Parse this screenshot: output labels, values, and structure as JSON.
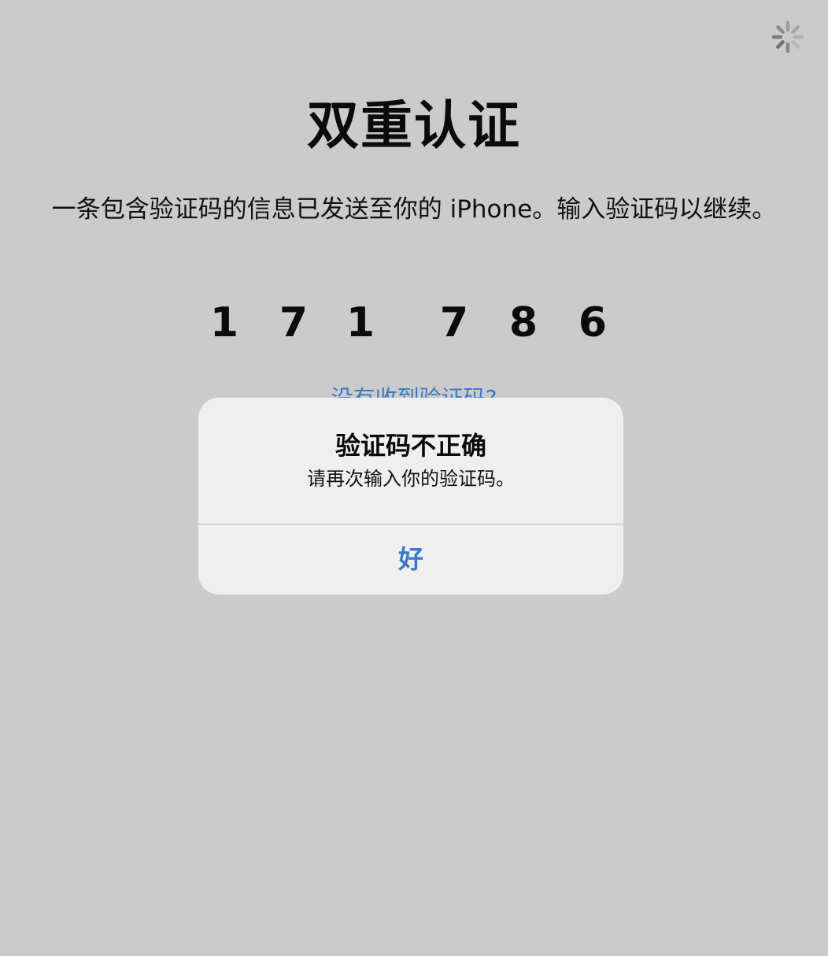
{
  "screen": {
    "title": "双重认证",
    "message": "一条包含验证码的信息已发送至你的 iPhone。输入验证码以继续。",
    "code_digits": [
      "1",
      "7",
      "1",
      "7",
      "8",
      "6"
    ],
    "resend_link": "没有收到验证码?",
    "loading_icon": "activity-spinner-icon"
  },
  "alert": {
    "title": "验证码不正确",
    "message": "请再次输入你的验证码。",
    "ok_label": "好"
  },
  "colors": {
    "background": "#cbcbcb",
    "alert_background": "#efefef",
    "accent": "#3a78c8",
    "text": "#0b0b0b"
  }
}
